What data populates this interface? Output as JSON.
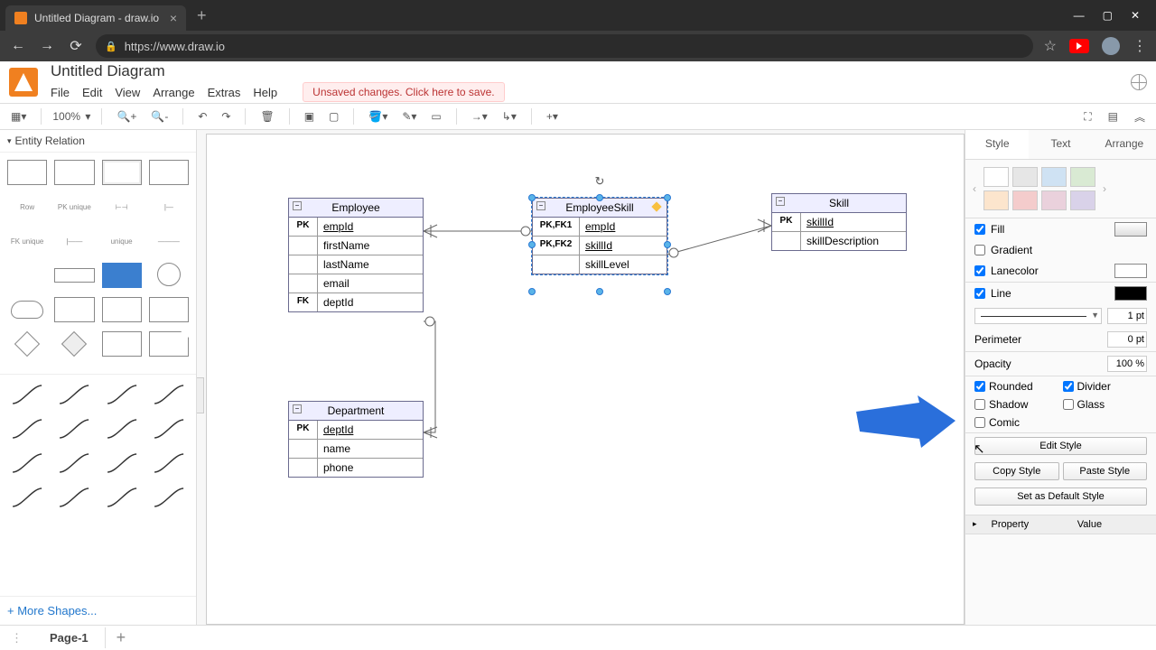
{
  "browser": {
    "tab_title": "Untitled Diagram - draw.io",
    "url": "https://www.draw.io"
  },
  "app": {
    "doc_title": "Untitled Diagram",
    "menu": {
      "file": "File",
      "edit": "Edit",
      "view": "View",
      "arrange": "Arrange",
      "extras": "Extras",
      "help": "Help"
    },
    "unsaved_msg": "Unsaved changes. Click here to save."
  },
  "toolbar": {
    "zoom": "100%"
  },
  "sidebar": {
    "palette_title": "Entity Relation",
    "row_label": "Row",
    "more_shapes": "+ More Shapes..."
  },
  "entities": {
    "employee": {
      "title": "Employee",
      "rows": [
        {
          "key": "PK",
          "name": "empId",
          "underline": true
        },
        {
          "key": "",
          "name": "firstName"
        },
        {
          "key": "",
          "name": "lastName"
        },
        {
          "key": "",
          "name": "email"
        },
        {
          "key": "FK",
          "name": "deptId"
        }
      ]
    },
    "employeeSkill": {
      "title": "EmployeeSkill",
      "rows": [
        {
          "key": "PK,FK1",
          "name": "empId",
          "underline": true
        },
        {
          "key": "PK,FK2",
          "name": "skillId",
          "underline": true
        },
        {
          "key": "",
          "name": "skillLevel"
        }
      ]
    },
    "skill": {
      "title": "Skill",
      "rows": [
        {
          "key": "PK",
          "name": "skillId",
          "underline": true
        },
        {
          "key": "",
          "name": "skillDescription"
        }
      ]
    },
    "department": {
      "title": "Department",
      "rows": [
        {
          "key": "PK",
          "name": "deptId",
          "underline": true
        },
        {
          "key": "",
          "name": "name"
        },
        {
          "key": "",
          "name": "phone"
        }
      ]
    }
  },
  "rightpanel": {
    "tabs": {
      "style": "Style",
      "text": "Text",
      "arrange": "Arrange"
    },
    "swatches": [
      "#ffffff",
      "#e6e6e6",
      "#cfe2f3",
      "#d9ead3",
      "#fce5cd",
      "#f4cccc",
      "#ead1dc",
      "#d9d2e9"
    ],
    "fill": {
      "label": "Fill",
      "checked": true,
      "color": "#ffffff"
    },
    "gradient": {
      "label": "Gradient",
      "checked": false
    },
    "lanecolor": {
      "label": "Lanecolor",
      "checked": true,
      "color": "#ffffff"
    },
    "line": {
      "label": "Line",
      "checked": true,
      "color": "#000000",
      "width": "1 pt"
    },
    "perimeter": {
      "label": "Perimeter",
      "value": "0 pt"
    },
    "opacity": {
      "label": "Opacity",
      "value": "100 %"
    },
    "rounded": {
      "label": "Rounded",
      "checked": true
    },
    "divider": {
      "label": "Divider",
      "checked": true
    },
    "shadow": {
      "label": "Shadow",
      "checked": false
    },
    "glass": {
      "label": "Glass",
      "checked": false
    },
    "comic": {
      "label": "Comic",
      "checked": false
    },
    "btn_edit": "Edit Style",
    "btn_copy": "Copy Style",
    "btn_paste": "Paste Style",
    "btn_default": "Set as Default Style",
    "prop_header": {
      "property": "Property",
      "value": "Value"
    }
  },
  "footer": {
    "page": "Page-1"
  }
}
